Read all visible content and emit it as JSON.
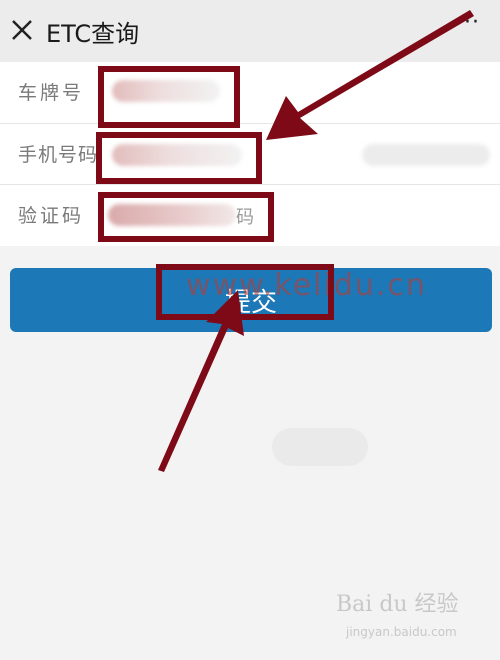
{
  "header": {
    "title": "ETC查询",
    "more": "···"
  },
  "form": {
    "plate_label": "车牌号",
    "phone_label": "手机号码",
    "code_label": "验证码",
    "code_suffix": "码"
  },
  "submit_label": "提交",
  "watermark": "www.kelidu.cn",
  "baidu": {
    "logo": "Bai du 经验",
    "url": "jingyan.baidu.com"
  },
  "colors": {
    "accent_button": "#1d78b8",
    "annotation": "#7d0a16"
  }
}
